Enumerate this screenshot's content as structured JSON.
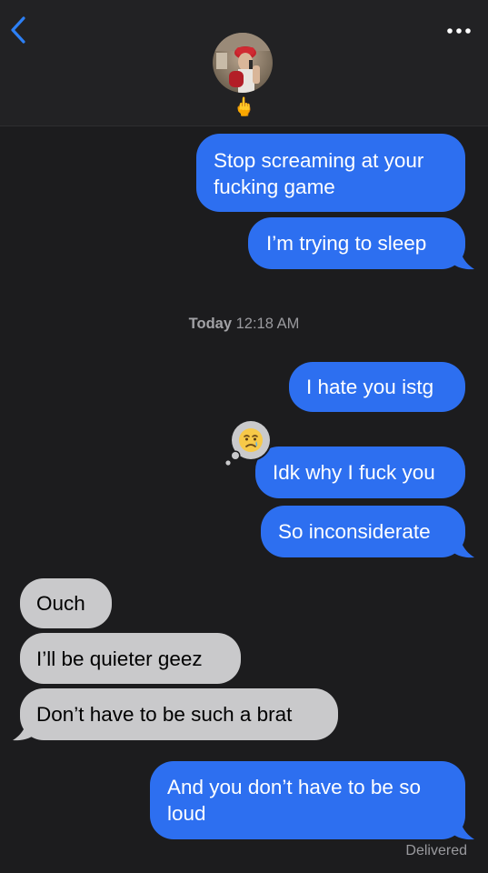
{
  "header": {
    "back_icon": "chevron-left-icon",
    "more_icon": "ellipsis-icon",
    "contact_name": "🖕",
    "accent_color": "#2d6ff0"
  },
  "conversation": {
    "messages": [
      {
        "direction": "sent",
        "text_lines": [
          "Stop screaming at your",
          "fucking game"
        ]
      },
      {
        "direction": "sent",
        "text_lines": [
          "I’m trying to sleep"
        ]
      },
      {
        "direction": "sent",
        "text_lines": [
          "I hate you istg"
        ]
      },
      {
        "direction": "sent",
        "text_lines": [
          "Idk why I fuck you"
        ],
        "tapback": "😢"
      },
      {
        "direction": "sent",
        "text_lines": [
          "So inconsiderate"
        ]
      },
      {
        "direction": "received",
        "text_lines": [
          "Ouch"
        ]
      },
      {
        "direction": "received",
        "text_lines": [
          "I’ll be quieter geez"
        ]
      },
      {
        "direction": "received",
        "text_lines": [
          "Don’t have to be such a brat"
        ]
      },
      {
        "direction": "sent",
        "text_lines": [
          "And you don’t have to be so",
          "loud"
        ]
      }
    ],
    "timestamp": {
      "day": "Today",
      "time": "12:18 AM"
    },
    "status": "Delivered",
    "sent_bubble_color": "#2d6ff0",
    "received_bubble_color": "#c9c9cb"
  }
}
